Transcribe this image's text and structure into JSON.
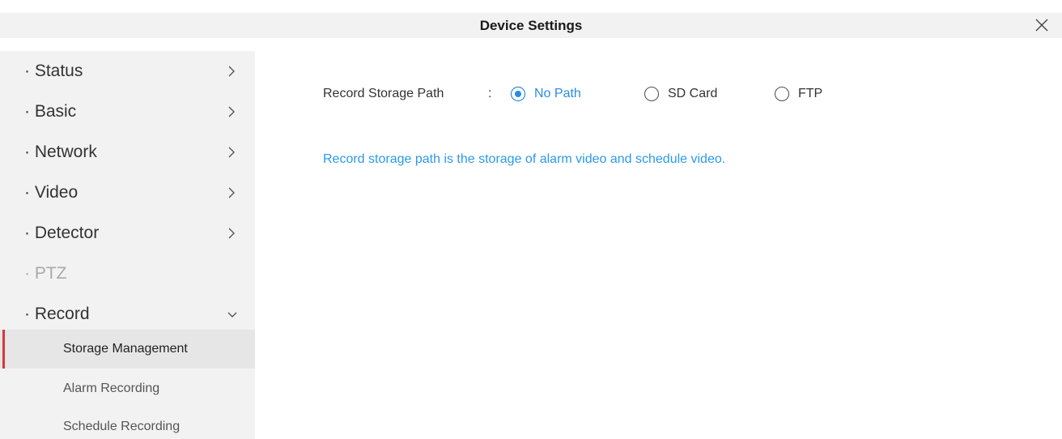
{
  "window": {
    "title": "Device Settings",
    "close_icon": "close-icon"
  },
  "sidebar": {
    "items": [
      {
        "label": "· Status",
        "expandable": true,
        "expanded": false,
        "disabled": false
      },
      {
        "label": "· Basic",
        "expandable": true,
        "expanded": false,
        "disabled": false
      },
      {
        "label": "· Network",
        "expandable": true,
        "expanded": false,
        "disabled": false
      },
      {
        "label": "· Video",
        "expandable": true,
        "expanded": false,
        "disabled": false
      },
      {
        "label": "· Detector",
        "expandable": true,
        "expanded": false,
        "disabled": false
      },
      {
        "label": "· PTZ",
        "expandable": false,
        "expanded": false,
        "disabled": true
      },
      {
        "label": "· Record",
        "expandable": true,
        "expanded": true,
        "disabled": false
      }
    ],
    "record_submenu": [
      {
        "label": "Storage Management",
        "active": true
      },
      {
        "label": "Alarm Recording",
        "active": false
      },
      {
        "label": "Schedule Recording",
        "active": false
      }
    ]
  },
  "storage": {
    "field_label": "Record Storage Path",
    "colon": ":",
    "options": [
      {
        "label": "No Path",
        "checked": true
      },
      {
        "label": "SD Card",
        "checked": false
      },
      {
        "label": "FTP",
        "checked": false
      }
    ],
    "info_text": "Record storage path is the storage of alarm video and schedule video."
  },
  "colors": {
    "accent_blue": "#2b8ce0",
    "active_marker_red": "#d9363e",
    "sidebar_bg": "#f2f2f2",
    "active_item_bg": "#e6e6e6"
  }
}
